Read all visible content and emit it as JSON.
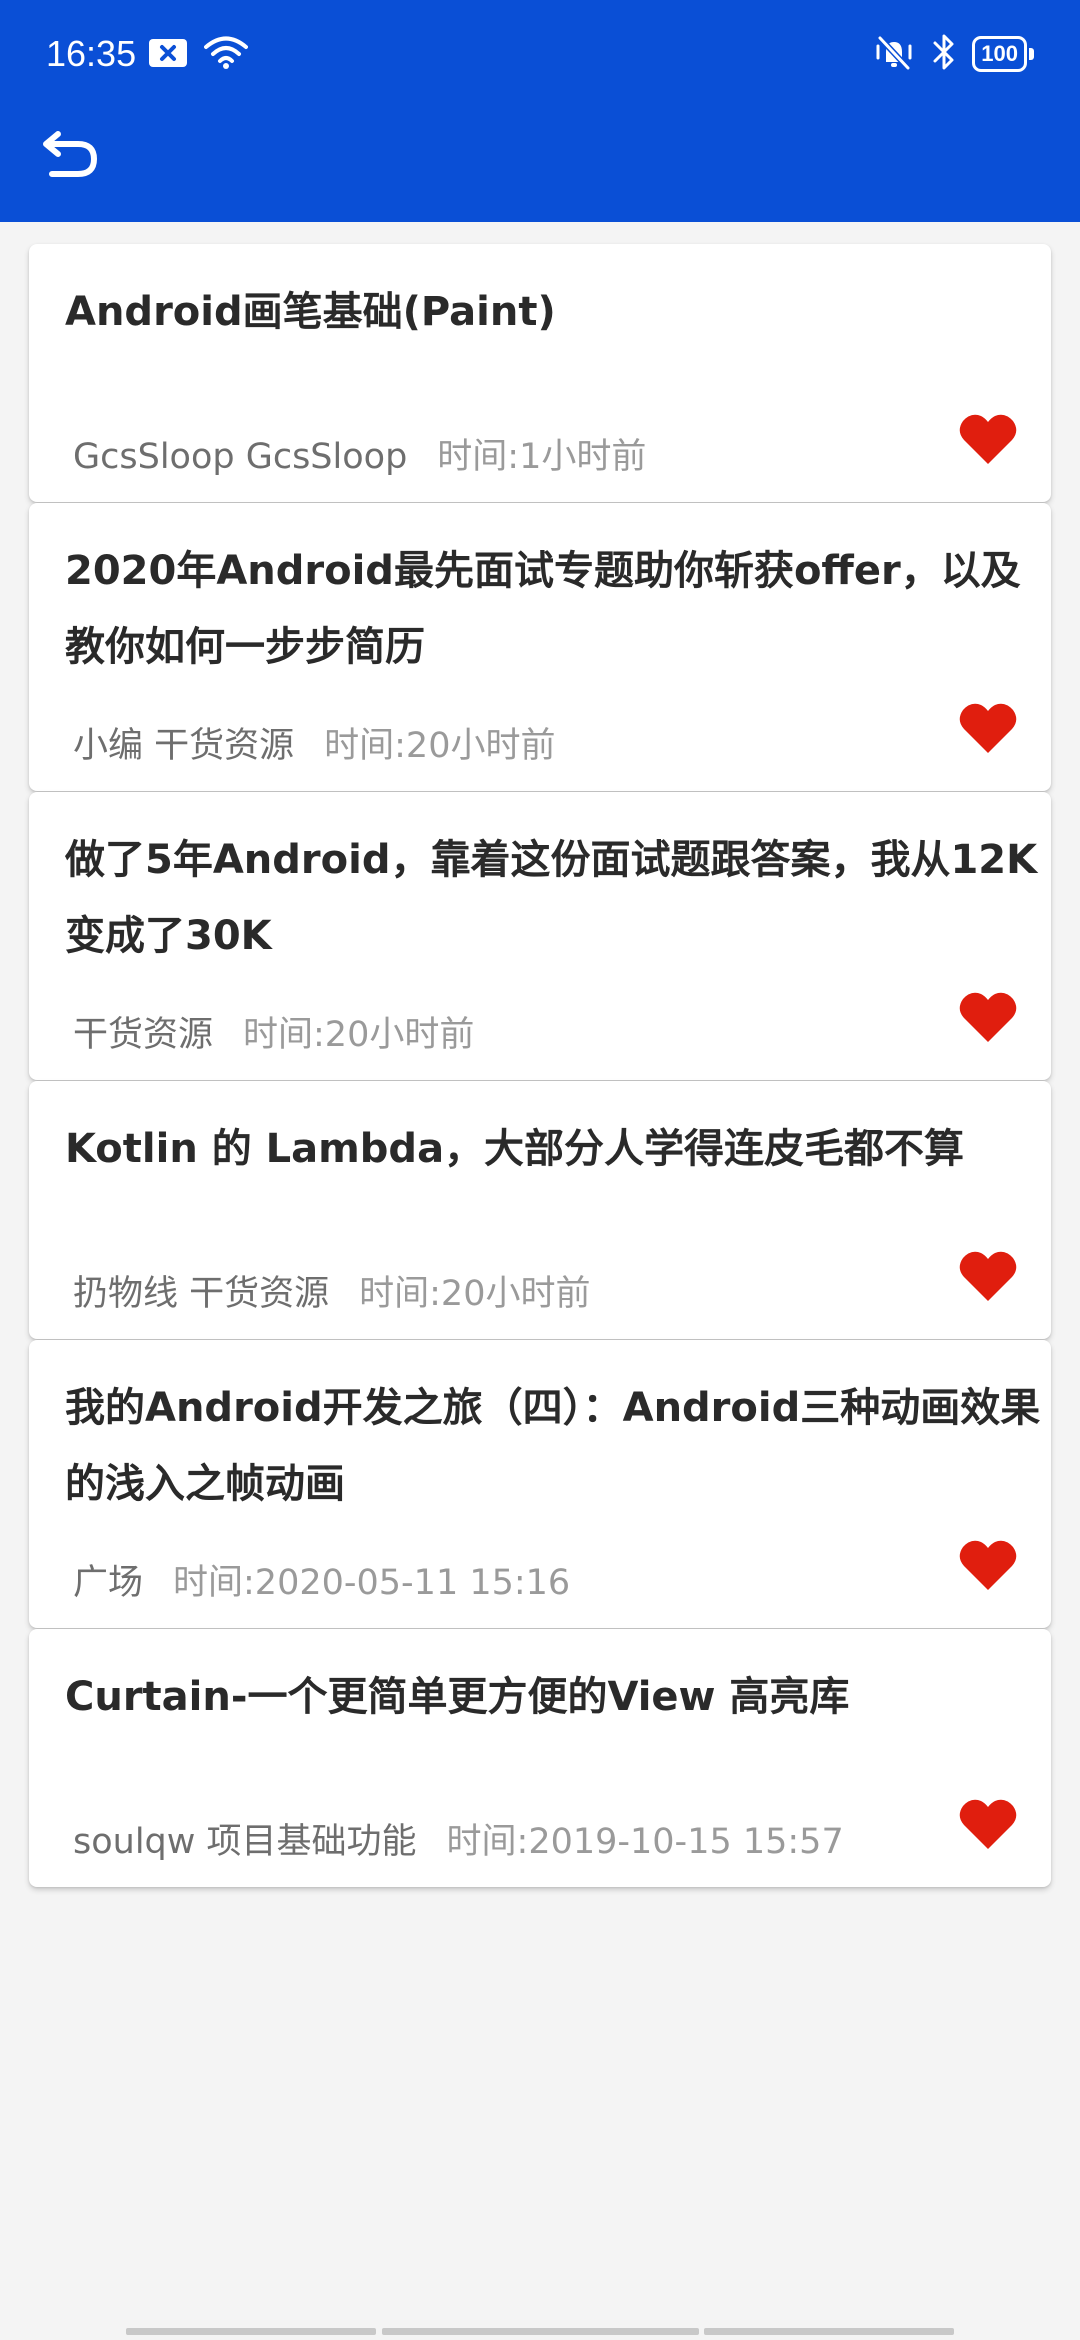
{
  "status_bar": {
    "time": "16:35",
    "battery": "100"
  },
  "toolbar": {
    "back_icon": "undo-arrow-icon"
  },
  "colors": {
    "app_bar": "#0a4fd6",
    "heart": "#e01e0e",
    "background": "#f4f4f4"
  },
  "articles": [
    {
      "title": "Android画笔基础(Paint)",
      "author": "GcsSloop GcsSloop",
      "time": "时间:1小时前"
    },
    {
      "title": "2020年Android最先面试专题助你斩获offer，以及教你如何一步步简历",
      "author": "小编 干货资源",
      "time": "时间:20小时前"
    },
    {
      "title": "做了5年Android，靠着这份面试题跟答案，我从12K变成了30K",
      "author": "干货资源",
      "time": "时间:20小时前"
    },
    {
      "title": "Kotlin 的 Lambda，大部分人学得连皮毛都不算",
      "author": "扔物线 干货资源",
      "time": "时间:20小时前"
    },
    {
      "title": "我的Android开发之旅（四）：Android三种动画效果的浅入之帧动画",
      "author": "广场",
      "time": "时间:2020-05-11 15:16"
    },
    {
      "title": "Curtain-一个更简单更方便的View 高亮库",
      "author": "soulqw 项目基础功能",
      "time": "时间:2019-10-15 15:57"
    }
  ]
}
